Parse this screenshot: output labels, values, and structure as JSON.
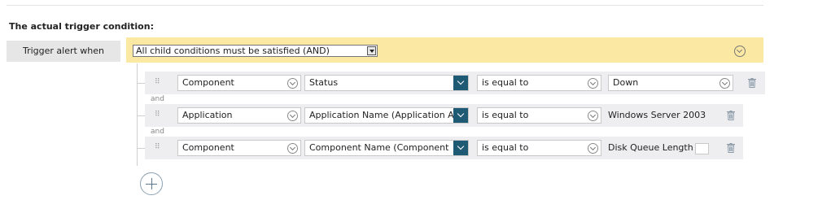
{
  "section_title": "The actual trigger condition:",
  "trigger_label": "Trigger alert when",
  "group": {
    "operator_select": "All child conditions must be satisfied (AND)",
    "connector_label": "and"
  },
  "conditions": [
    {
      "entity": "Component",
      "property": "Status",
      "comparison": "is equal to",
      "value": "Down"
    },
    {
      "entity": "Application",
      "property": "Application Name (Application A",
      "comparison": "is equal to",
      "value": "Windows Server 2003"
    },
    {
      "entity": "Component",
      "property": "Component Name (Component",
      "comparison": "is equal to",
      "value": "Disk Queue Length"
    }
  ],
  "colors": {
    "and_bar": "#fbe8a2",
    "row_bg": "#eeeef1",
    "property_button": "#1e5a73"
  },
  "icons": [
    "collapse-chevron-icon",
    "drag-handle-icon",
    "dropdown-chevron-icon",
    "trash-icon",
    "add-plus-icon"
  ]
}
